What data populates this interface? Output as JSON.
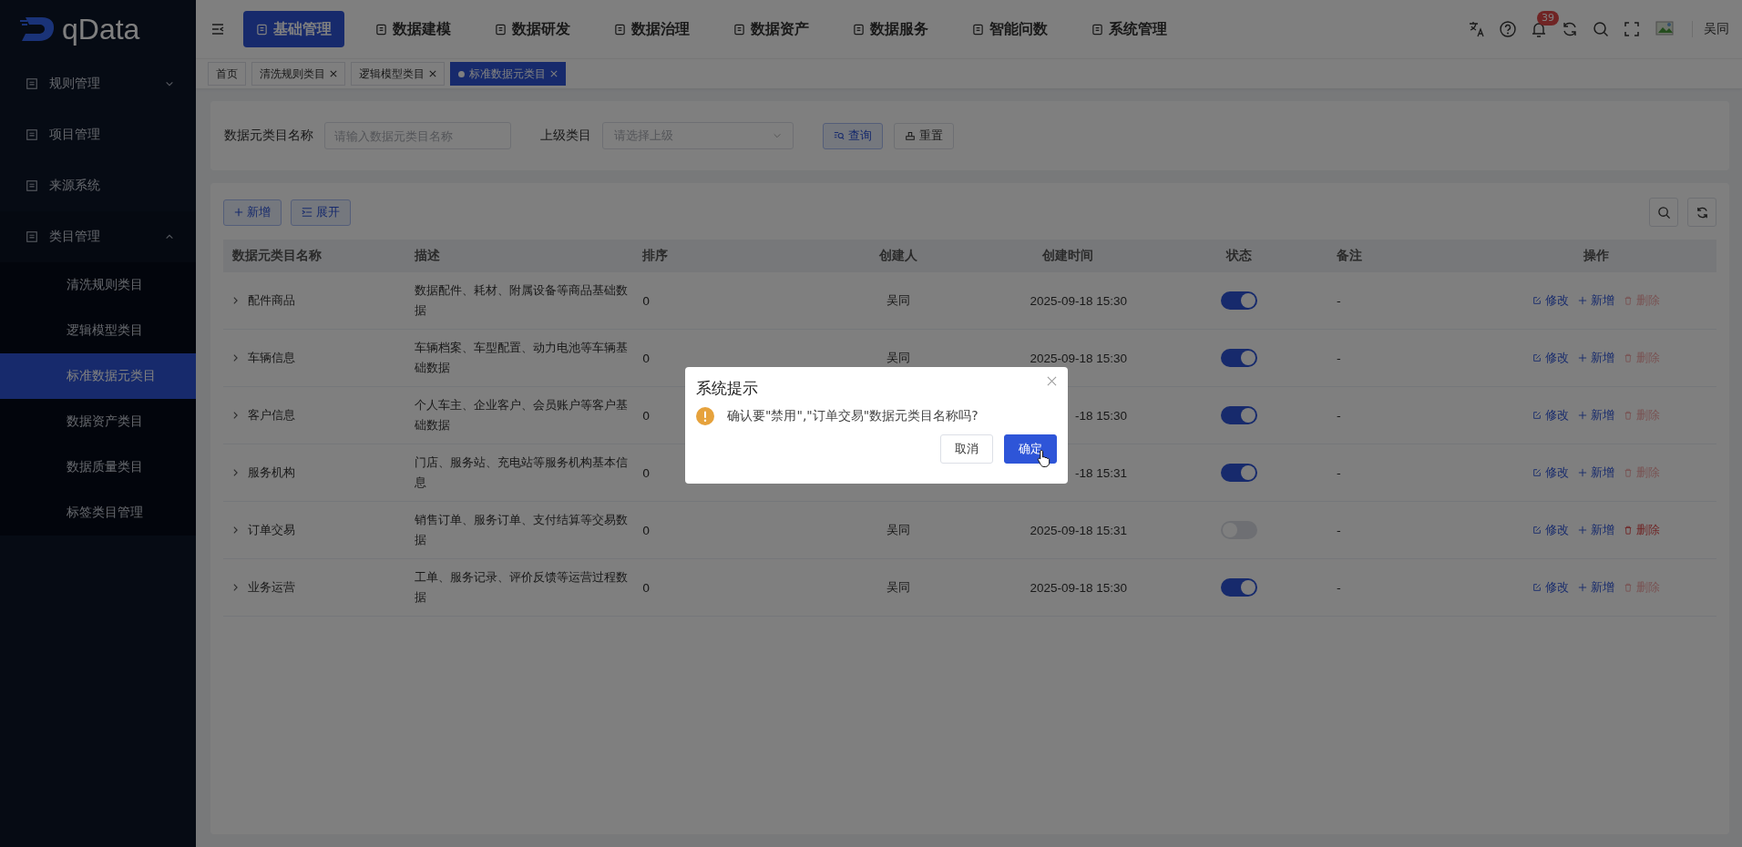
{
  "logo": {
    "text": "qData"
  },
  "top_nav": [
    {
      "label": "基础管理",
      "selected": true
    },
    {
      "label": "数据建模",
      "selected": false
    },
    {
      "label": "数据研发",
      "selected": false
    },
    {
      "label": "数据治理",
      "selected": false
    },
    {
      "label": "数据资产",
      "selected": false
    },
    {
      "label": "数据服务",
      "selected": false
    },
    {
      "label": "智能问数",
      "selected": false
    },
    {
      "label": "系统管理",
      "selected": false
    }
  ],
  "header": {
    "notification_count": "39",
    "user_name": "吴同"
  },
  "page_tabs": [
    {
      "label": "首页",
      "selected": false,
      "closable": false
    },
    {
      "label": "清洗规则类目",
      "selected": false,
      "closable": true
    },
    {
      "label": "逻辑模型类目",
      "selected": false,
      "closable": true
    },
    {
      "label": "标准数据元类目",
      "selected": true,
      "closable": true
    }
  ],
  "sidebar": {
    "items": [
      {
        "label": "规则管理",
        "expanded": false
      },
      {
        "label": "项目管理"
      },
      {
        "label": "来源系统"
      },
      {
        "label": "类目管理",
        "expanded": true,
        "children": [
          {
            "label": "清洗规则类目",
            "selected": false
          },
          {
            "label": "逻辑模型类目",
            "selected": false
          },
          {
            "label": "标准数据元类目",
            "selected": true
          },
          {
            "label": "数据资产类目",
            "selected": false
          },
          {
            "label": "数据质量类目",
            "selected": false
          },
          {
            "label": "标签类目管理",
            "selected": false
          }
        ]
      }
    ]
  },
  "filter": {
    "name_label": "数据元类目名称",
    "name_placeholder": "请输入数据元类目名称",
    "parent_label": "上级类目",
    "parent_placeholder": "请选择上级",
    "search_button": "查询",
    "reset_button": "重置"
  },
  "toolbar": {
    "add_button": "新增",
    "expand_button": "展开"
  },
  "table": {
    "columns": [
      "数据元类目名称",
      "描述",
      "排序",
      "创建人",
      "创建时间",
      "状态",
      "备注",
      "操作"
    ],
    "rows": [
      {
        "name": "配件商品",
        "description": "数据配件、耗材、附属设备等商品基础数据",
        "sort": "0",
        "creator": "吴同",
        "created": "2025-09-18 15:30",
        "enabled": true,
        "note": "-",
        "actions": [
          "修改",
          "新增",
          "删除"
        ]
      },
      {
        "name": "车辆信息",
        "description": "车辆档案、车型配置、动力电池等车辆基础数据",
        "sort": "0",
        "creator": "吴同",
        "created": "2025-09-18 15:30",
        "enabled": true,
        "note": "-",
        "actions": [
          "修改",
          "新增",
          "删除"
        ]
      },
      {
        "name": "客户信息",
        "description": "个人车主、企业客户、会员账户等客户基础数据",
        "sort": "0",
        "created": "-18 15:30",
        "enabled": true,
        "note": "-",
        "actions": [
          "修改",
          "新增",
          "删除"
        ]
      },
      {
        "name": "服务机构",
        "description": "门店、服务站、充电站等服务机构基本信息",
        "sort": "0",
        "created": "-18 15:31",
        "enabled": true,
        "note": "-",
        "actions": [
          "修改",
          "新增",
          "删除"
        ]
      },
      {
        "name": "订单交易",
        "description": "销售订单、服务订单、支付结算等交易数据",
        "sort": "0",
        "creator": "吴同",
        "created": "2025-09-18 15:31",
        "enabled": false,
        "note": "-",
        "actions": [
          "修改",
          "新增",
          "删除"
        ]
      },
      {
        "name": "业务运营",
        "description": "工单、服务记录、评价反馈等运营过程数据",
        "sort": "0",
        "creator": "吴同",
        "created": "2025-09-18 15:30",
        "enabled": true,
        "note": "-",
        "actions": [
          "修改",
          "新增",
          "删除"
        ]
      }
    ]
  },
  "dialog": {
    "title": "系统提示",
    "message": "确认要\"禁用\",\"订单交易\"数据元类目名称吗?",
    "cancel_button": "取消",
    "confirm_button": "确定"
  }
}
